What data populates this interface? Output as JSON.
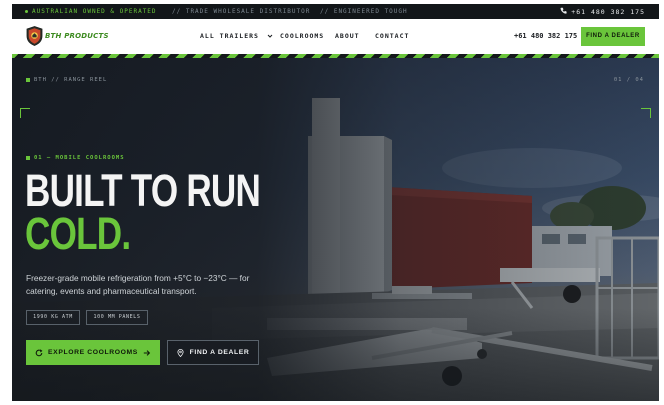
{
  "topbar": {
    "tagline": "AUSTRALIAN OWNED & OPERATED",
    "segment2": "// TRADE WHOLESALE DISTRIBUTOR",
    "segment3": "// ENGINEERED TOUGH",
    "phone": "+61 480 382 175",
    "phone_icon": "phone-icon"
  },
  "nav": {
    "logo_text": "BTH PRODUCTS",
    "menu": [
      {
        "label": "ALL TRAILERS",
        "icon": "chevron-down-icon"
      },
      {
        "label": "COOLROOMS"
      },
      {
        "label": "ABOUT"
      },
      {
        "label": "CONTACT"
      }
    ],
    "phone": "+61 480 382 175",
    "cta": "FIND A DEALER"
  },
  "hero": {
    "breadcrumb": "BTH // RANGE REEL",
    "counter": "01 / 04",
    "eyebrow": "01 — MOBILE COOLROOMS",
    "headline_line1": "BUILT TO RUN",
    "headline_line2": "COLD.",
    "lead": "Freezer-grade mobile refrigeration from +5°C to −23°C — for catering, events and pharmaceutical transport.",
    "chips": [
      "1990 KG ATM",
      "100 MM PANELS"
    ],
    "primary_cta": "EXPLORE COOLROOMS",
    "primary_icon_left": "refresh-icon",
    "primary_icon_right": "arrow-right-icon",
    "secondary_cta": "FIND A DEALER",
    "secondary_icon": "map-pin-icon"
  },
  "colors": {
    "accent": "#6ac53b",
    "dark": "#1c2128",
    "topbar": "#121619"
  }
}
